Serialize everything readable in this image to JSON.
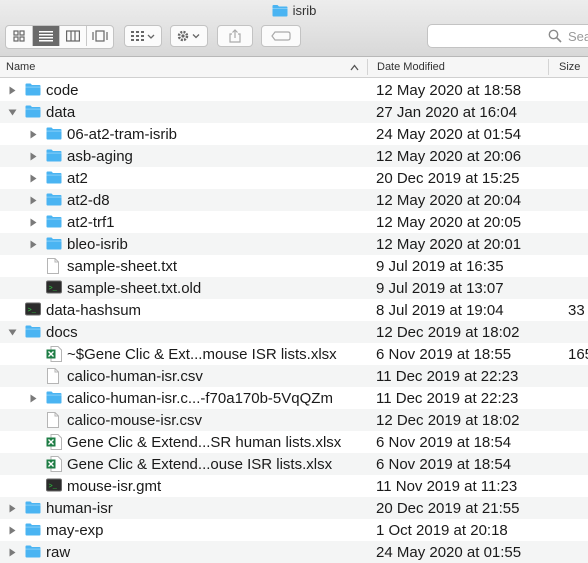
{
  "window": {
    "title": "isrib"
  },
  "search": {
    "placeholder": "Sea"
  },
  "columns": {
    "name": "Name",
    "date": "Date Modified",
    "size": "Size"
  },
  "colors": {
    "folder": "#4ab4f2",
    "excel": "#1e7d45",
    "terminal": "#2b2b2b"
  },
  "items": [
    {
      "name": "code",
      "date": "12 May 2020 at 18:58",
      "size": "",
      "icon": "folder-icon",
      "disclosure": "collapsed",
      "depth": 0
    },
    {
      "name": "data",
      "date": "27 Jan 2020 at 16:04",
      "size": "",
      "icon": "folder-icon",
      "disclosure": "expanded",
      "depth": 0
    },
    {
      "name": "06-at2-tram-isrib",
      "date": "24 May 2020 at 01:54",
      "size": "",
      "icon": "folder-icon",
      "disclosure": "collapsed",
      "depth": 1
    },
    {
      "name": "asb-aging",
      "date": "12 May 2020 at 20:06",
      "size": "",
      "icon": "folder-icon",
      "disclosure": "collapsed",
      "depth": 1
    },
    {
      "name": "at2",
      "date": "20 Dec 2019 at 15:25",
      "size": "",
      "icon": "folder-icon",
      "disclosure": "collapsed",
      "depth": 1
    },
    {
      "name": "at2-d8",
      "date": "12 May 2020 at 20:04",
      "size": "",
      "icon": "folder-icon",
      "disclosure": "collapsed",
      "depth": 1
    },
    {
      "name": "at2-trf1",
      "date": "12 May 2020 at 20:05",
      "size": "",
      "icon": "folder-icon",
      "disclosure": "collapsed",
      "depth": 1
    },
    {
      "name": "bleo-isrib",
      "date": "12 May 2020 at 20:01",
      "size": "",
      "icon": "folder-icon",
      "disclosure": "collapsed",
      "depth": 1
    },
    {
      "name": "sample-sheet.txt",
      "date": "9 Jul 2019 at 16:35",
      "size": "",
      "icon": "text-file-icon",
      "disclosure": "none",
      "depth": 1
    },
    {
      "name": "sample-sheet.txt.old",
      "date": "9 Jul 2019 at 13:07",
      "size": "",
      "icon": "terminal-file-icon",
      "disclosure": "none",
      "depth": 1
    },
    {
      "name": "data-hashsum",
      "date": "8 Jul 2019 at 19:04",
      "size": "33",
      "icon": "terminal-file-icon",
      "disclosure": "none",
      "depth": 0
    },
    {
      "name": "docs",
      "date": "12 Dec 2019 at 18:02",
      "size": "",
      "icon": "folder-icon",
      "disclosure": "expanded",
      "depth": 0
    },
    {
      "name": "~$Gene Clic & Ext...mouse ISR lists.xlsx",
      "date": "6 Nov 2019 at 18:55",
      "size": "165",
      "icon": "excel-file-icon",
      "disclosure": "none",
      "depth": 1
    },
    {
      "name": "calico-human-isr.csv",
      "date": "11 Dec 2019 at 22:23",
      "size": "",
      "icon": "text-file-icon",
      "disclosure": "none",
      "depth": 1
    },
    {
      "name": "calico-human-isr.c...-f70a170b-5VqQZm",
      "date": "11 Dec 2019 at 22:23",
      "size": "",
      "icon": "folder-icon",
      "disclosure": "collapsed",
      "depth": 1
    },
    {
      "name": "calico-mouse-isr.csv",
      "date": "12 Dec 2019 at 18:02",
      "size": "",
      "icon": "text-file-icon",
      "disclosure": "none",
      "depth": 1
    },
    {
      "name": "Gene Clic & Extend...SR human lists.xlsx",
      "date": "6 Nov 2019 at 18:54",
      "size": "",
      "icon": "excel-file-icon",
      "disclosure": "none",
      "depth": 1
    },
    {
      "name": "Gene Clic & Extend...ouse ISR lists.xlsx",
      "date": "6 Nov 2019 at 18:54",
      "size": "",
      "icon": "excel-file-icon",
      "disclosure": "none",
      "depth": 1
    },
    {
      "name": "mouse-isr.gmt",
      "date": "11 Nov 2019 at 11:23",
      "size": "",
      "icon": "terminal-file-icon",
      "disclosure": "none",
      "depth": 1
    },
    {
      "name": "human-isr",
      "date": "20 Dec 2019 at 21:55",
      "size": "",
      "icon": "folder-icon",
      "disclosure": "collapsed",
      "depth": 0
    },
    {
      "name": "may-exp",
      "date": "1 Oct 2019 at 20:18",
      "size": "",
      "icon": "folder-icon",
      "disclosure": "collapsed",
      "depth": 0
    },
    {
      "name": "raw",
      "date": "24 May 2020 at 01:55",
      "size": "",
      "icon": "folder-icon",
      "disclosure": "collapsed",
      "depth": 0
    }
  ]
}
